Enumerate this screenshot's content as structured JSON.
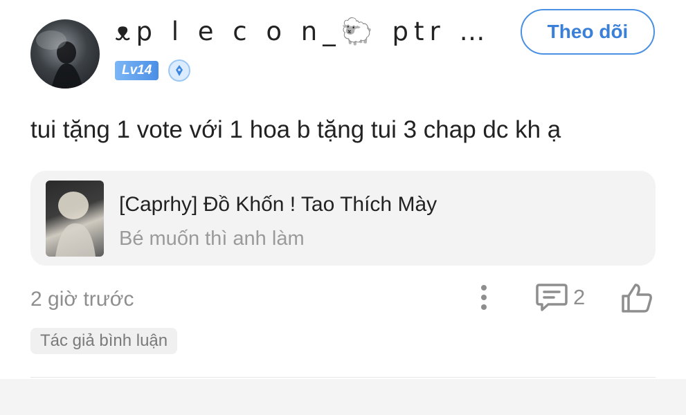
{
  "comment": {
    "user": {
      "name": "ᴥp l e c o n_🐑 ptr | l o v…",
      "level": "Lv14",
      "follow_label": "Theo dõi"
    },
    "text": "tui tặng 1 vote với 1 hoa b tặng tui 3 chap dc kh ạ",
    "story": {
      "title": "[Caprhy] Đồ Khốn ! Tao Thích Mày",
      "subtitle": "Bé muốn thì anh làm"
    },
    "timestamp": "2 giờ trước",
    "reply_count": "2",
    "author_tag": "Tác giả bình luận"
  },
  "colors": {
    "accent": "#4a90e2",
    "level_badge": "#5fa2ec",
    "muted": "#8e8e8e",
    "card_bg": "#f3f3f3"
  },
  "icons": {
    "rank": "pen-nib-badge-icon",
    "more": "more-vertical-icon",
    "comment": "comment-icon",
    "like": "thumbs-up-icon"
  }
}
